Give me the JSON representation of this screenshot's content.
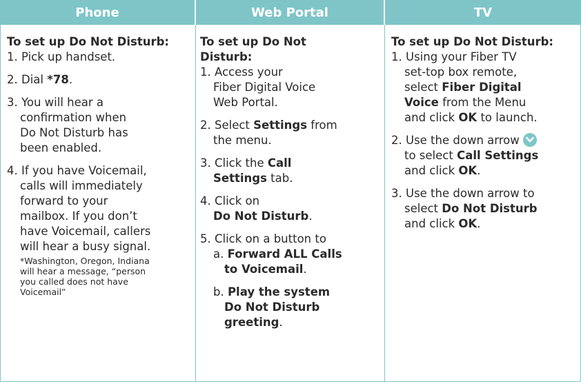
{
  "headers": {
    "phone": "Phone",
    "web": "Web Portal",
    "tv": "TV"
  },
  "phone": {
    "title": "To set up Do Not Disturb:",
    "s1": "1. Pick up handset.",
    "s2_pre": "2. Dial ",
    "s2_code": "*78",
    "s2_post": ".",
    "s3_a": "3. You will hear a",
    "s3_b": "confirmation when",
    "s3_c": "Do Not Disturb has",
    "s3_d": "been enabled.",
    "s4_a": "4. If you have Voicemail,",
    "s4_b": "calls will immediately",
    "s4_c": "forward to your",
    "s4_d": "mailbox. If you don’t",
    "s4_e": "have Voicemail, callers",
    "s4_f": "will hear a busy signal.",
    "fn_a": "*Washington, Oregon, Indiana",
    "fn_b": "will hear a message, “person",
    "fn_c": "you called does not have",
    "fn_d": "Voicemail”"
  },
  "web": {
    "title_a": "To set up Do Not",
    "title_b": "Disturb:",
    "s1_a": "1. Access your",
    "s1_b": "Fiber Digital Voice",
    "s1_c": "Web Portal.",
    "s2_pre": "2. Select ",
    "s2_bold": "Settings",
    "s2_post": " from",
    "s2_b": "the menu.",
    "s3_pre": "3. Click the ",
    "s3_bold_a": "Call",
    "s3_bold_b": "Settings",
    "s3_post": " tab.",
    "s4_a": "4. Click on",
    "s4_bold": "Do Not Disturb",
    "s4_post": ".",
    "s5": "5. Click on a button to",
    "sa_pre": "a. ",
    "sa_bold_a": "Forward ALL Calls",
    "sa_bold_b": "to Voicemail",
    "sa_post": ".",
    "sb_pre": "b. ",
    "sb_bold_a": "Play the system",
    "sb_bold_b": "Do Not Disturb",
    "sb_bold_c": "greeting",
    "sb_post": "."
  },
  "tv": {
    "title": "To set up Do Not Disturb:",
    "s1_a": "1. Using your Fiber TV",
    "s1_b": "set-top box remote,",
    "s1_pre": "select ",
    "s1_bold_a": "Fiber Digital",
    "s1_bold_b": "Voice",
    "s1_mid": " from the Menu",
    "s1_pre2": "and click ",
    "s1_ok": "OK",
    "s1_post": " to launch.",
    "s2_a": "2. Use the down arrow ",
    "s2_pre": "to select ",
    "s2_bold": "Call Settings",
    "s2_pre2": "and click ",
    "s2_ok": "OK",
    "s2_post": ".",
    "s3_a": "3. Use the down arrow to",
    "s3_pre": "select ",
    "s3_bold": "Do Not Disturb",
    "s3_pre2": "and click ",
    "s3_ok": "OK",
    "s3_post": ".",
    "arrow_icon": "chevron-down-circle-icon",
    "accent": "#7fc5c8"
  }
}
